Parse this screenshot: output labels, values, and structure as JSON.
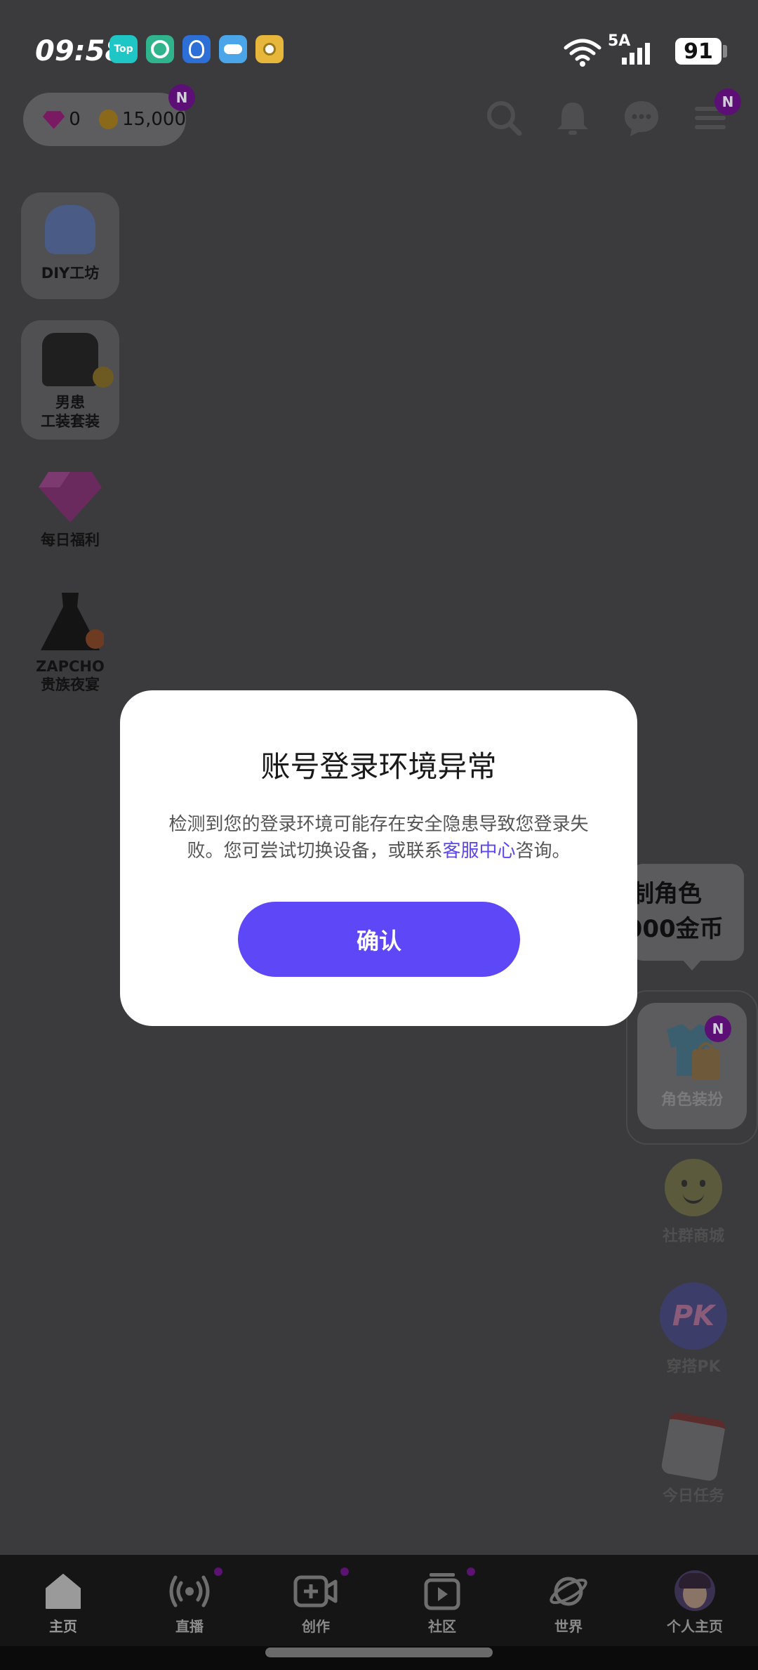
{
  "status_bar": {
    "time": "09:58",
    "network": "5A",
    "battery": "91",
    "app_icons": [
      {
        "name": "top-app-icon",
        "text": "Top",
        "color": "#1fc6c6"
      },
      {
        "name": "lens-app-icon",
        "text": "",
        "color": "#2fb48e"
      },
      {
        "name": "bulb-app-icon",
        "text": "",
        "color": "#2c6fd6"
      },
      {
        "name": "weather-app-icon",
        "text": "",
        "color": "#4aa6e8"
      },
      {
        "name": "yellow-app-icon",
        "text": "",
        "color": "#e6b73b"
      }
    ]
  },
  "currency": {
    "diamonds": "0",
    "coins": "15,000",
    "badge": "N"
  },
  "header": {
    "menu_badge": "N"
  },
  "left_tiles": [
    {
      "label": "DIY工坊"
    },
    {
      "label": "男患\n工装套装"
    },
    {
      "label": "每日福利"
    },
    {
      "label": "ZAPCHO\n贵族夜宴"
    }
  ],
  "tooltip": {
    "line1": "定制角色",
    "line2": "3000金币"
  },
  "right_items": [
    {
      "label": "角色装扮",
      "badge": "N"
    },
    {
      "label": "社群商城"
    },
    {
      "label": "穿搭PK"
    },
    {
      "label": "今日任务"
    }
  ],
  "modal": {
    "title": "账号登录环境异常",
    "body_prefix": "检测到您的登录环境可能存在安全隐患导致您登录失败。您可尝试切换设备，或联系",
    "body_link": "客服中心",
    "body_suffix": "咨询。",
    "confirm_label": "确认"
  },
  "bottom_nav": [
    {
      "label": "主页",
      "active": true
    },
    {
      "label": "直播",
      "dot": true
    },
    {
      "label": "创作",
      "dot": true
    },
    {
      "label": "社区",
      "dot": true
    },
    {
      "label": "世界"
    },
    {
      "label": "个人主页"
    }
  ],
  "colors": {
    "accent": "#5d47f6",
    "link": "#5b47f0",
    "overlay_bg": "#3b3b3d",
    "badge": "#5c0f75"
  }
}
